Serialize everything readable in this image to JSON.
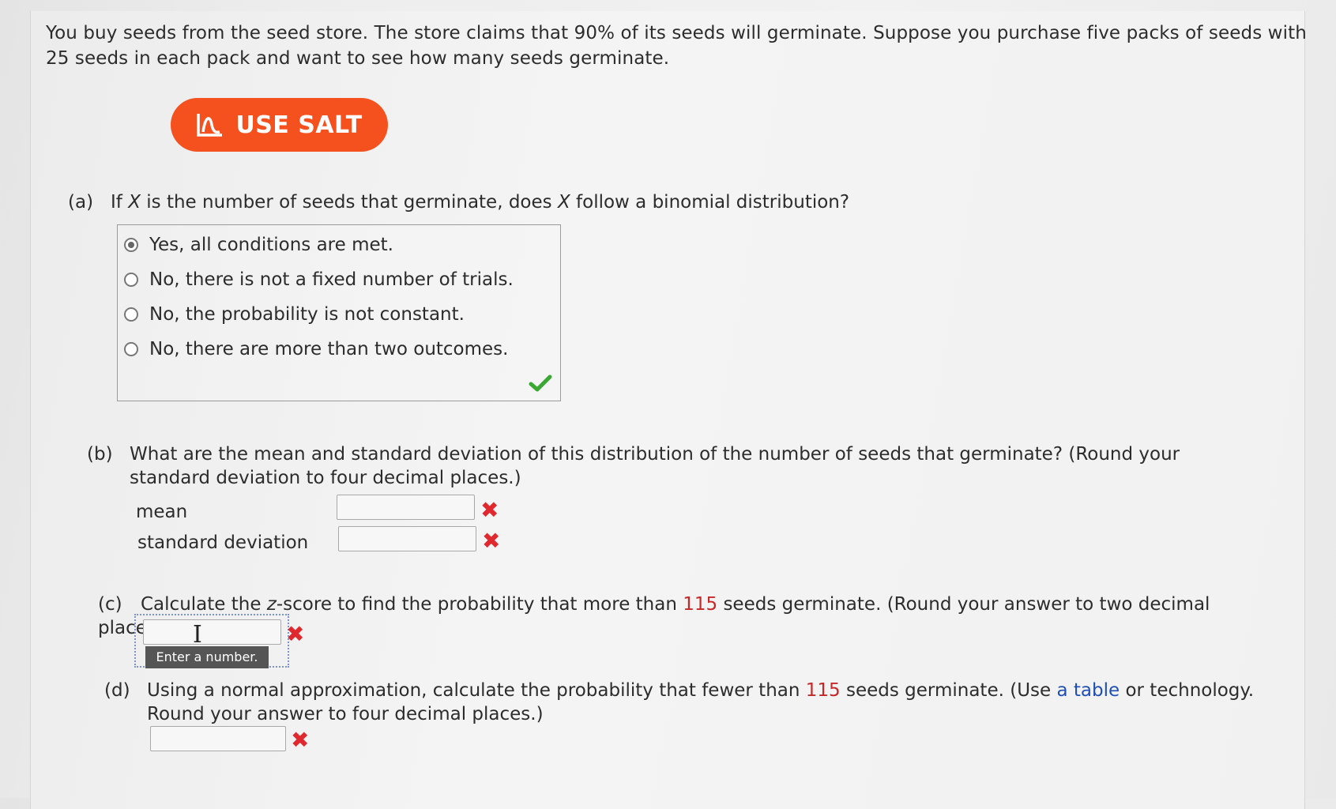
{
  "intro": "You buy seeds from the seed store. The store claims that 90% of its seeds will germinate. Suppose you purchase five packs of seeds with 25 seeds in each pack and want to see how many seeds germinate.",
  "salt_button": "USE SALT",
  "part_a": {
    "label": "(a)",
    "question_pre": "If ",
    "var1": "X",
    "question_mid": " is the number of seeds that germinate, does ",
    "var2": "X",
    "question_post": " follow a binomial distribution?",
    "choices": [
      "Yes, all conditions are met.",
      "No, there is not a fixed number of trials.",
      "No, the probability is not constant.",
      "No, there are more than two outcomes."
    ],
    "selected_index": 0,
    "status": "correct"
  },
  "part_b": {
    "label": "(b)",
    "question": "What are the mean and standard deviation of this distribution of the number of seeds that germinate? (Round your standard deviation to four decimal places.)",
    "mean_label": "mean",
    "sd_label": "standard deviation",
    "mean_value": "",
    "sd_value": ""
  },
  "part_c": {
    "label": "(c)",
    "q_pre": "Calculate the ",
    "z": "z",
    "q_mid": "-score to find the probability that more than ",
    "number": "115",
    "q_post": " seeds germinate. (Round your answer to two decimal places.)",
    "tooltip": "Enter a number."
  },
  "part_d": {
    "label": "(d)",
    "q_pre": "Using a normal approximation, calculate the probability that fewer than ",
    "number": "115",
    "q_mid": " seeds germinate. (Use ",
    "link": "a table",
    "q_post": " or technology. Round your answer to four decimal places.)"
  },
  "colors": {
    "salt": "#f4511e",
    "incorrect": "#e0282f",
    "correct": "#3aa832",
    "link": "#1f4fb5"
  },
  "icons": {
    "salt": "salt-chart-icon",
    "correct": "checkmark-icon",
    "incorrect": "x-mark-icon"
  }
}
